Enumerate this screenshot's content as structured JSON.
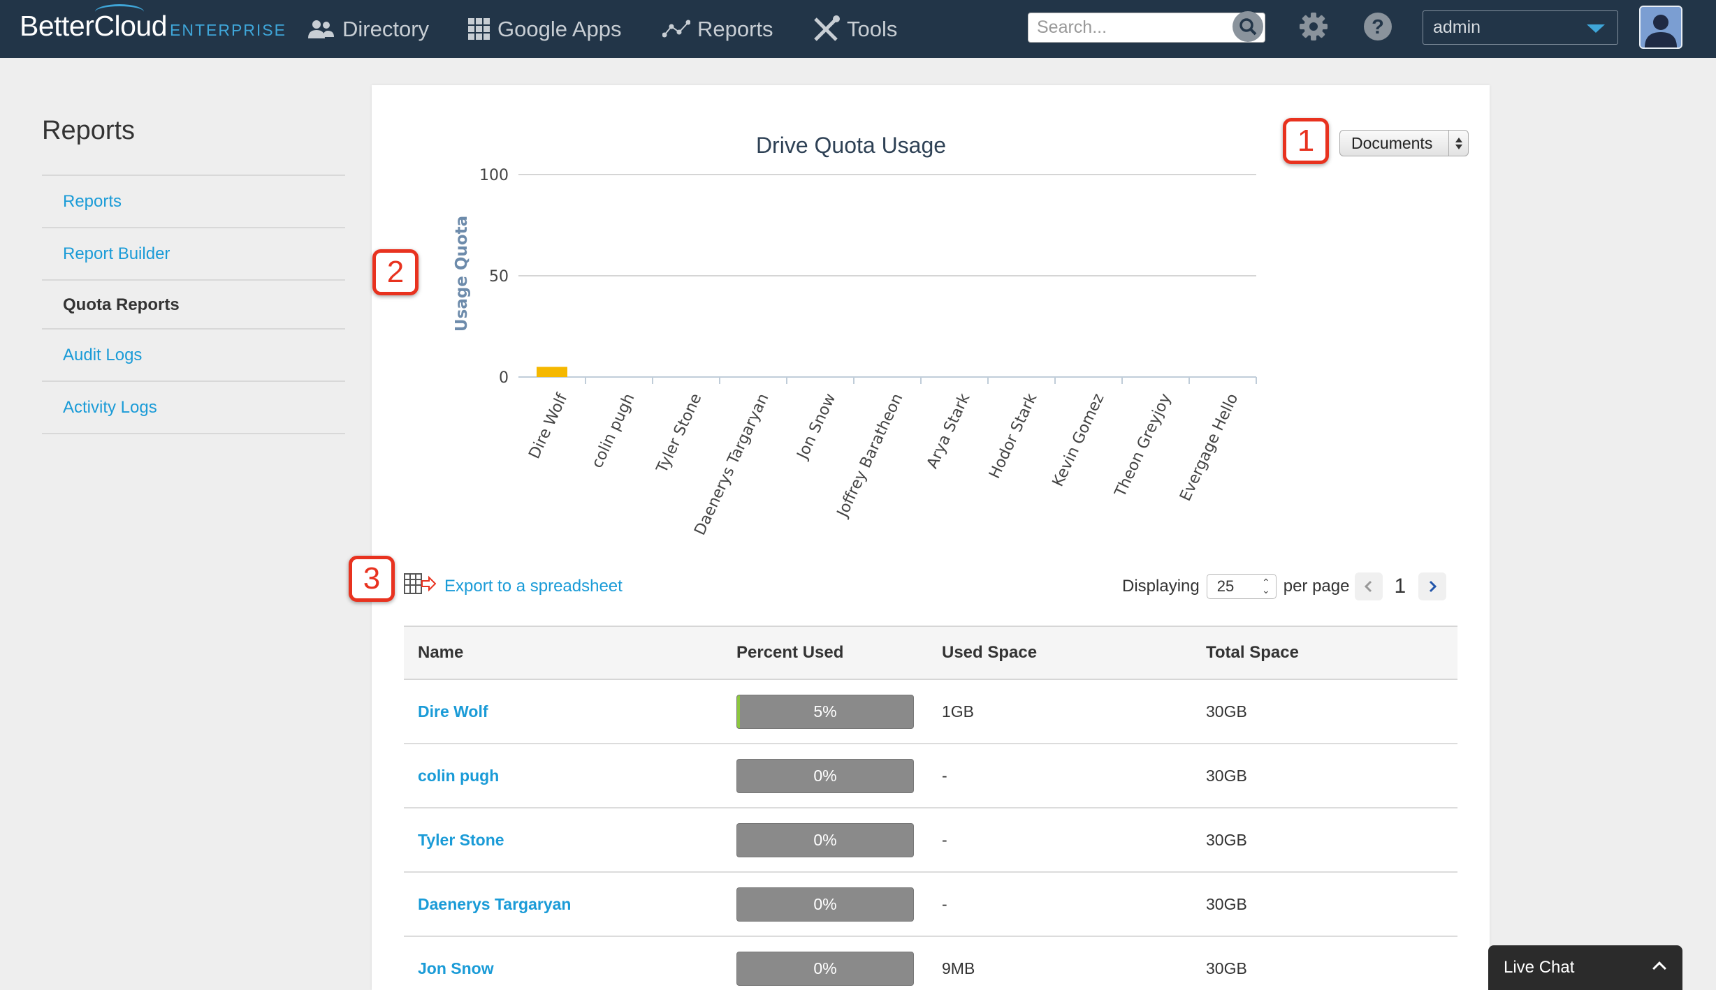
{
  "brand": {
    "name": "BetterCloud",
    "edition": "ENTERPRISE"
  },
  "topnav": {
    "items": [
      {
        "label": "Directory",
        "icon": "users-icon"
      },
      {
        "label": "Google Apps",
        "icon": "grid-icon"
      },
      {
        "label": "Reports",
        "icon": "chart-icon"
      },
      {
        "label": "Tools",
        "icon": "tools-icon"
      }
    ],
    "search_placeholder": "Search...",
    "account": "admin"
  },
  "sidebar": {
    "title": "Reports",
    "items": [
      {
        "label": "Reports",
        "active": false
      },
      {
        "label": "Report Builder",
        "active": false
      },
      {
        "label": "Quota Reports",
        "active": true
      },
      {
        "label": "Audit Logs",
        "active": false
      },
      {
        "label": "Activity Logs",
        "active": false
      }
    ]
  },
  "filter": {
    "selected": "Documents"
  },
  "callouts": [
    "1",
    "2",
    "3"
  ],
  "chart_data": {
    "type": "bar",
    "title": "Drive Quota Usage",
    "ylabel": "Usage Quota",
    "xlabel": "",
    "ylim": [
      0,
      100
    ],
    "yticks": [
      0,
      50,
      100
    ],
    "grid": true,
    "bar_color": "#f5b800",
    "categories": [
      "Dire Wolf",
      "colin pugh",
      "Tyler Stone",
      "Daenerys Targaryan",
      "Jon Snow",
      "Joffrey Baratheon",
      "Arya Stark",
      "Hodor Stark",
      "Kevin Gomez",
      "Theon Greyjoy",
      "Evergage Hello"
    ],
    "values": [
      5,
      0,
      0,
      0,
      0,
      0,
      0,
      0,
      0,
      0,
      0
    ]
  },
  "export": {
    "label": "Export to a spreadsheet"
  },
  "pagination": {
    "prefix": "Displaying",
    "per_page": "25",
    "suffix": "per page",
    "page": "1"
  },
  "table": {
    "headers": [
      "Name",
      "Percent Used",
      "Used Space",
      "Total Space"
    ],
    "rows": [
      {
        "name": "Dire Wolf",
        "percent": "5%",
        "percent_value": 5,
        "used": "1GB",
        "total": "30GB"
      },
      {
        "name": "colin pugh",
        "percent": "0%",
        "percent_value": 0,
        "used": "-",
        "total": "30GB"
      },
      {
        "name": "Tyler Stone",
        "percent": "0%",
        "percent_value": 0,
        "used": "-",
        "total": "30GB"
      },
      {
        "name": "Daenerys Targaryan",
        "percent": "0%",
        "percent_value": 0,
        "used": "-",
        "total": "30GB"
      },
      {
        "name": "Jon Snow",
        "percent": "0%",
        "percent_value": 0,
        "used": "9MB",
        "total": "30GB"
      }
    ]
  },
  "live_chat": {
    "label": "Live Chat"
  },
  "colors": {
    "nav_bg": "#223548",
    "link": "#1a9bd7",
    "accent": "#3fa6d9",
    "callout": "#e8321f",
    "usage_fill": "#8cc63f"
  }
}
